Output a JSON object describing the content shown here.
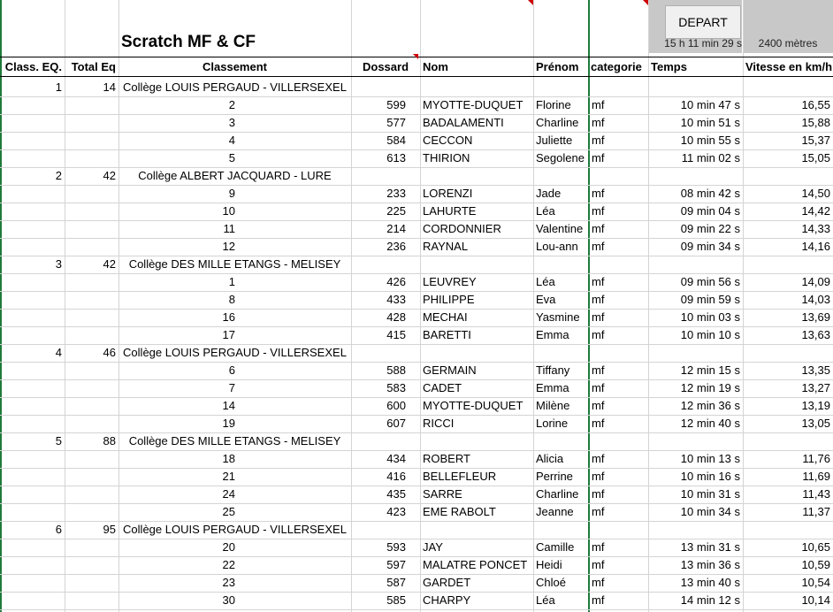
{
  "sheet": {
    "title": "Scratch MF & CF",
    "depart_button": "DEPART",
    "start_time": "15 h 11 min 29 s",
    "distance": "2400 mètres",
    "headers": {
      "class_eq": "Class. EQ.",
      "total_eq": "Total Eq",
      "classement": "Classement",
      "dossard": "Dossard",
      "nom": "Nom",
      "prenom": "Prénom",
      "categorie": "categorie",
      "temps": "Temps",
      "vitesse": "Vitesse en km/h"
    },
    "teams": [
      {
        "rank": "1",
        "total": "14",
        "name": "Collège LOUIS PERGAUD - VILLERSEXEL",
        "runners": [
          {
            "place": "2",
            "bib": "599",
            "nom": "MYOTTE-DUQUET",
            "prenom": "Florine",
            "cat": "mf",
            "temps": "10 min 47 s",
            "vitesse": "16,55"
          },
          {
            "place": "3",
            "bib": "577",
            "nom": "BADALAMENTI",
            "prenom": "Charline",
            "cat": "mf",
            "temps": "10 min 51 s",
            "vitesse": "15,88"
          },
          {
            "place": "4",
            "bib": "584",
            "nom": "CECCON",
            "prenom": "Juliette",
            "cat": "mf",
            "temps": "10 min 55 s",
            "vitesse": "15,37"
          },
          {
            "place": "5",
            "bib": "613",
            "nom": "THIRION",
            "prenom": "Segolene",
            "cat": "mf",
            "temps": "11 min 02 s",
            "vitesse": "15,05"
          }
        ]
      },
      {
        "rank": "2",
        "total": "42",
        "name": "Collège ALBERT JACQUARD - LURE",
        "runners": [
          {
            "place": "9",
            "bib": "233",
            "nom": "LORENZI",
            "prenom": "Jade",
            "cat": "mf",
            "temps": "08 min 42 s",
            "vitesse": "14,50"
          },
          {
            "place": "10",
            "bib": "225",
            "nom": "LAHURTE",
            "prenom": "Léa",
            "cat": "mf",
            "temps": "09 min 04 s",
            "vitesse": "14,42"
          },
          {
            "place": "11",
            "bib": "214",
            "nom": "CORDONNIER",
            "prenom": "Valentine",
            "cat": "mf",
            "temps": "09 min 22 s",
            "vitesse": "14,33"
          },
          {
            "place": "12",
            "bib": "236",
            "nom": "RAYNAL",
            "prenom": "Lou-ann",
            "cat": "mf",
            "temps": "09 min 34 s",
            "vitesse": "14,16"
          }
        ]
      },
      {
        "rank": "3",
        "total": "42",
        "name": "Collège DES MILLE ETANGS - MELISEY",
        "runners": [
          {
            "place": "1",
            "bib": "426",
            "nom": "LEUVREY",
            "prenom": "Léa",
            "cat": "mf",
            "temps": "09 min 56 s",
            "vitesse": "14,09"
          },
          {
            "place": "8",
            "bib": "433",
            "nom": "PHILIPPE",
            "prenom": "Eva",
            "cat": "mf",
            "temps": "09 min 59 s",
            "vitesse": "14,03"
          },
          {
            "place": "16",
            "bib": "428",
            "nom": "MECHAI",
            "prenom": "Yasmine",
            "cat": "mf",
            "temps": "10 min 03 s",
            "vitesse": "13,69"
          },
          {
            "place": "17",
            "bib": "415",
            "nom": "BARETTI",
            "prenom": "Emma",
            "cat": "mf",
            "temps": "10 min 10 s",
            "vitesse": "13,63"
          }
        ]
      },
      {
        "rank": "4",
        "total": "46",
        "name": "Collège LOUIS PERGAUD - VILLERSEXEL",
        "runners": [
          {
            "place": "6",
            "bib": "588",
            "nom": "GERMAIN",
            "prenom": "Tiffany",
            "cat": "mf",
            "temps": "12 min 15 s",
            "vitesse": "13,35"
          },
          {
            "place": "7",
            "bib": "583",
            "nom": "CADET",
            "prenom": "Emma",
            "cat": "mf",
            "temps": "12 min 19 s",
            "vitesse": "13,27"
          },
          {
            "place": "14",
            "bib": "600",
            "nom": "MYOTTE-DUQUET",
            "prenom": "Milène",
            "cat": "mf",
            "temps": "12 min 36 s",
            "vitesse": "13,19"
          },
          {
            "place": "19",
            "bib": "607",
            "nom": "RICCI",
            "prenom": "Lorine",
            "cat": "mf",
            "temps": "12 min 40 s",
            "vitesse": "13,05"
          }
        ]
      },
      {
        "rank": "5",
        "total": "88",
        "name": "Collège DES MILLE ETANGS - MELISEY",
        "runners": [
          {
            "place": "18",
            "bib": "434",
            "nom": "ROBERT",
            "prenom": "Alicia",
            "cat": "mf",
            "temps": "10 min 13 s",
            "vitesse": "11,76"
          },
          {
            "place": "21",
            "bib": "416",
            "nom": "BELLEFLEUR",
            "prenom": "Perrine",
            "cat": "mf",
            "temps": "10 min 16 s",
            "vitesse": "11,69"
          },
          {
            "place": "24",
            "bib": "435",
            "nom": "SARRE",
            "prenom": "Charline",
            "cat": "mf",
            "temps": "10 min 31 s",
            "vitesse": "11,43"
          },
          {
            "place": "25",
            "bib": "423",
            "nom": "EME RABOLT",
            "prenom": "Jeanne",
            "cat": "mf",
            "temps": "10 min 34 s",
            "vitesse": "11,37"
          }
        ]
      },
      {
        "rank": "6",
        "total": "95",
        "name": "Collège LOUIS PERGAUD - VILLERSEXEL",
        "runners": [
          {
            "place": "20",
            "bib": "593",
            "nom": "JAY",
            "prenom": "Camille",
            "cat": "mf",
            "temps": "13 min 31 s",
            "vitesse": "10,65"
          },
          {
            "place": "22",
            "bib": "597",
            "nom": "MALATRE PONCET",
            "prenom": "Heidi",
            "cat": "mf",
            "temps": "13 min 36 s",
            "vitesse": "10,59"
          },
          {
            "place": "23",
            "bib": "587",
            "nom": "GARDET",
            "prenom": "Chloé",
            "cat": "mf",
            "temps": "13 min 40 s",
            "vitesse": "10,54"
          },
          {
            "place": "30",
            "bib": "585",
            "nom": "CHARPY",
            "prenom": "Léa",
            "cat": "mf",
            "temps": "14 min 12 s",
            "vitesse": "10,14"
          }
        ]
      }
    ]
  }
}
